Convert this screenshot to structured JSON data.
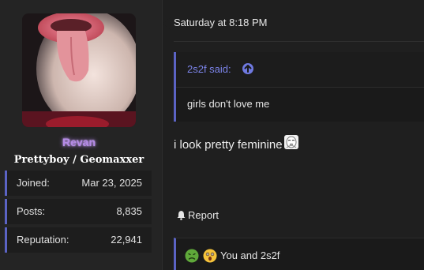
{
  "user": {
    "name": "Revan",
    "title": "Prettyboy / Geomaxxer",
    "stats": [
      {
        "label": "Joined:",
        "value": "Mar 23, 2025"
      },
      {
        "label": "Posts:",
        "value": "8,835"
      },
      {
        "label": "Reputation:",
        "value": "22,941"
      }
    ],
    "name_color": "#b58be6"
  },
  "post": {
    "date": "Saturday at 8:18 PM",
    "quote": {
      "author": "2s2f said:",
      "text": "girls don't love me"
    },
    "message": "i look pretty feminine",
    "report_label": "Report",
    "reactions_text": "You and 2s2f"
  },
  "colors": {
    "accent": "#5b63c4",
    "quote_author": "#7b83e8"
  },
  "icons": [
    "avatar-image",
    "arrow-up-circle-icon",
    "pensive-emoji-icon",
    "bell-icon",
    "sick-emoji-icon",
    "astonished-emoji-icon"
  ]
}
